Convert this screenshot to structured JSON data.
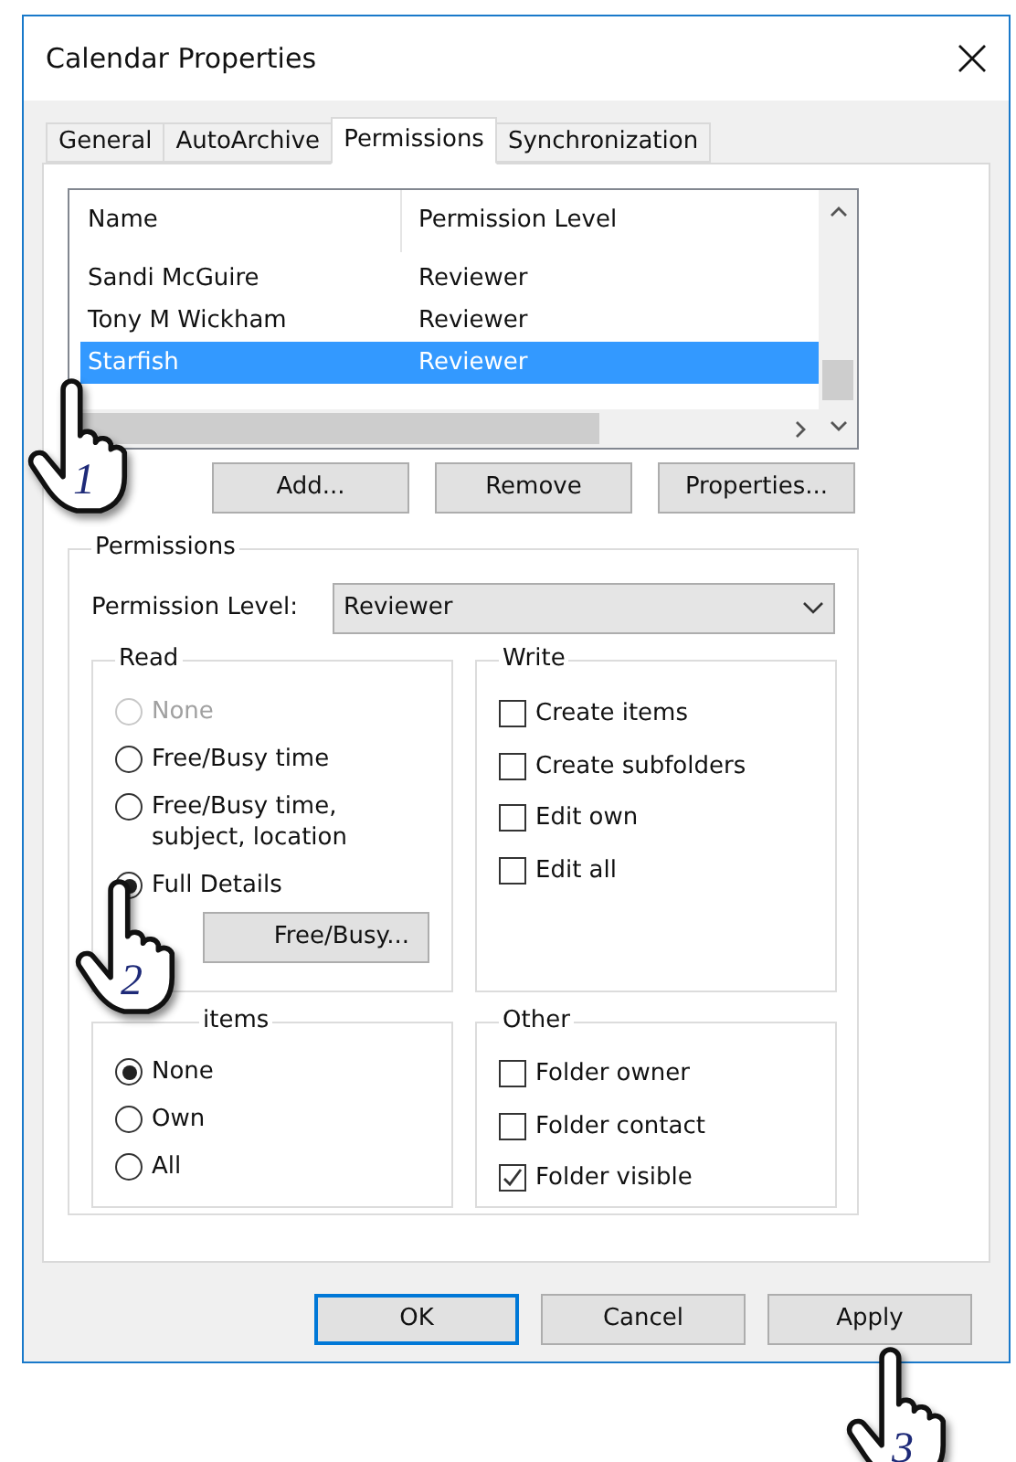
{
  "window": {
    "title": "Calendar Properties"
  },
  "tabs": [
    {
      "label": "General",
      "selected": false
    },
    {
      "label": "AutoArchive",
      "selected": false
    },
    {
      "label": "Permissions",
      "selected": true
    },
    {
      "label": "Synchronization",
      "selected": false
    }
  ],
  "list": {
    "columns": [
      "Name",
      "Permission Level"
    ],
    "rows": [
      {
        "name": "Sandi McGuire",
        "level": "Reviewer",
        "selected": false
      },
      {
        "name": "Tony M Wickham",
        "level": "Reviewer",
        "selected": false
      },
      {
        "name": "Starfish",
        "level": "Reviewer",
        "selected": true
      }
    ]
  },
  "list_buttons": [
    "Add...",
    "Remove",
    "Properties..."
  ],
  "permissions": {
    "title": "Permissions",
    "level_label": "Permission Level:",
    "level_value": "Reviewer",
    "read": {
      "title": "Read",
      "options": [
        {
          "label": "None",
          "selected": false,
          "disabled": true
        },
        {
          "label": "Free/Busy time",
          "selected": false,
          "disabled": false
        },
        {
          "label": "Free/Busy time, subject, location",
          "selected": false,
          "disabled": false
        },
        {
          "label": "Full Details",
          "selected": true,
          "disabled": false
        }
      ],
      "button": "Free/Busy..."
    },
    "write": {
      "title": "Write",
      "options": [
        {
          "label": "Create items",
          "checked": false
        },
        {
          "label": "Create subfolders",
          "checked": false
        },
        {
          "label": "Edit own",
          "checked": false
        },
        {
          "label": "Edit all",
          "checked": false
        }
      ]
    },
    "delete": {
      "title": "items",
      "options": [
        {
          "label": "None",
          "selected": true
        },
        {
          "label": "Own",
          "selected": false
        },
        {
          "label": "All",
          "selected": false
        }
      ]
    },
    "other": {
      "title": "Other",
      "options": [
        {
          "label": "Folder owner",
          "checked": false
        },
        {
          "label": "Folder contact",
          "checked": false
        },
        {
          "label": "Folder visible",
          "checked": true
        }
      ]
    }
  },
  "buttons": [
    {
      "label": "OK",
      "default": true
    },
    {
      "label": "Cancel",
      "default": false
    },
    {
      "label": "Apply",
      "default": false
    }
  ],
  "steps": [
    "1",
    "2",
    "3"
  ]
}
